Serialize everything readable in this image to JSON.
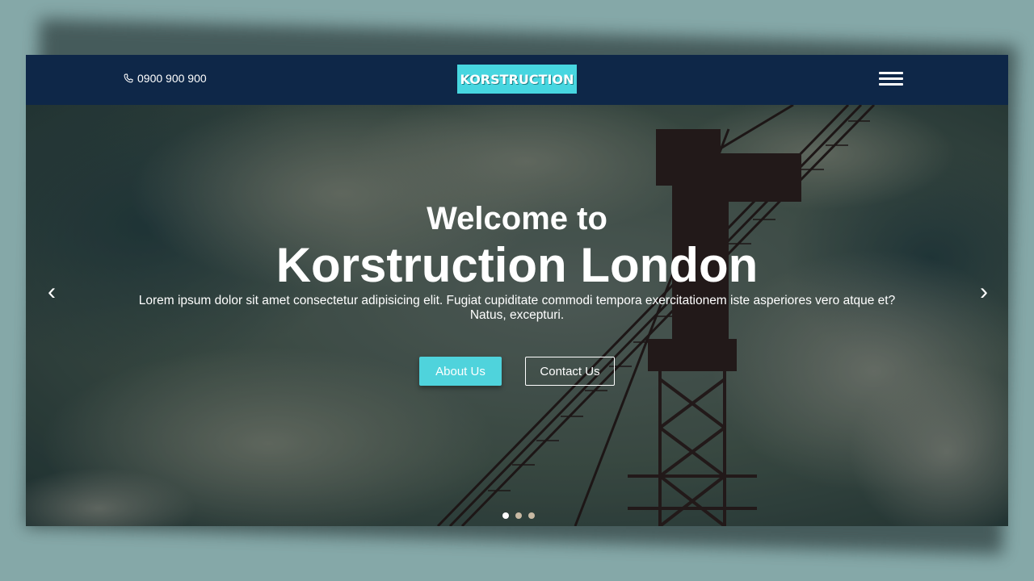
{
  "header": {
    "phone_icon": "phone-icon",
    "phone": "0900 900 900",
    "logo_text": "KORSTRUCTION",
    "menu_icon": "hamburger-menu-icon"
  },
  "hero": {
    "welcome": "Welcome to",
    "title": "Korstruction London",
    "lead": "Lorem ipsum dolor sit amet consectetur adipisicing elit. Fugiat cupiditate commodi tempora exercitationem iste asperiores vero atque et? Natus, excepturi.",
    "about_label": "About Us",
    "contact_label": "Contact Us",
    "prev_arrow": "‹",
    "next_arrow": "›",
    "slide_count": 3,
    "active_slide": 1
  },
  "colors": {
    "navbar": "#0e2748",
    "logo_bg": "#47d6e0",
    "about_button": "#4fd3dc",
    "backdrop": "#85a8a8",
    "dot": "#c8b9a3",
    "dot_active": "#ffffff"
  }
}
